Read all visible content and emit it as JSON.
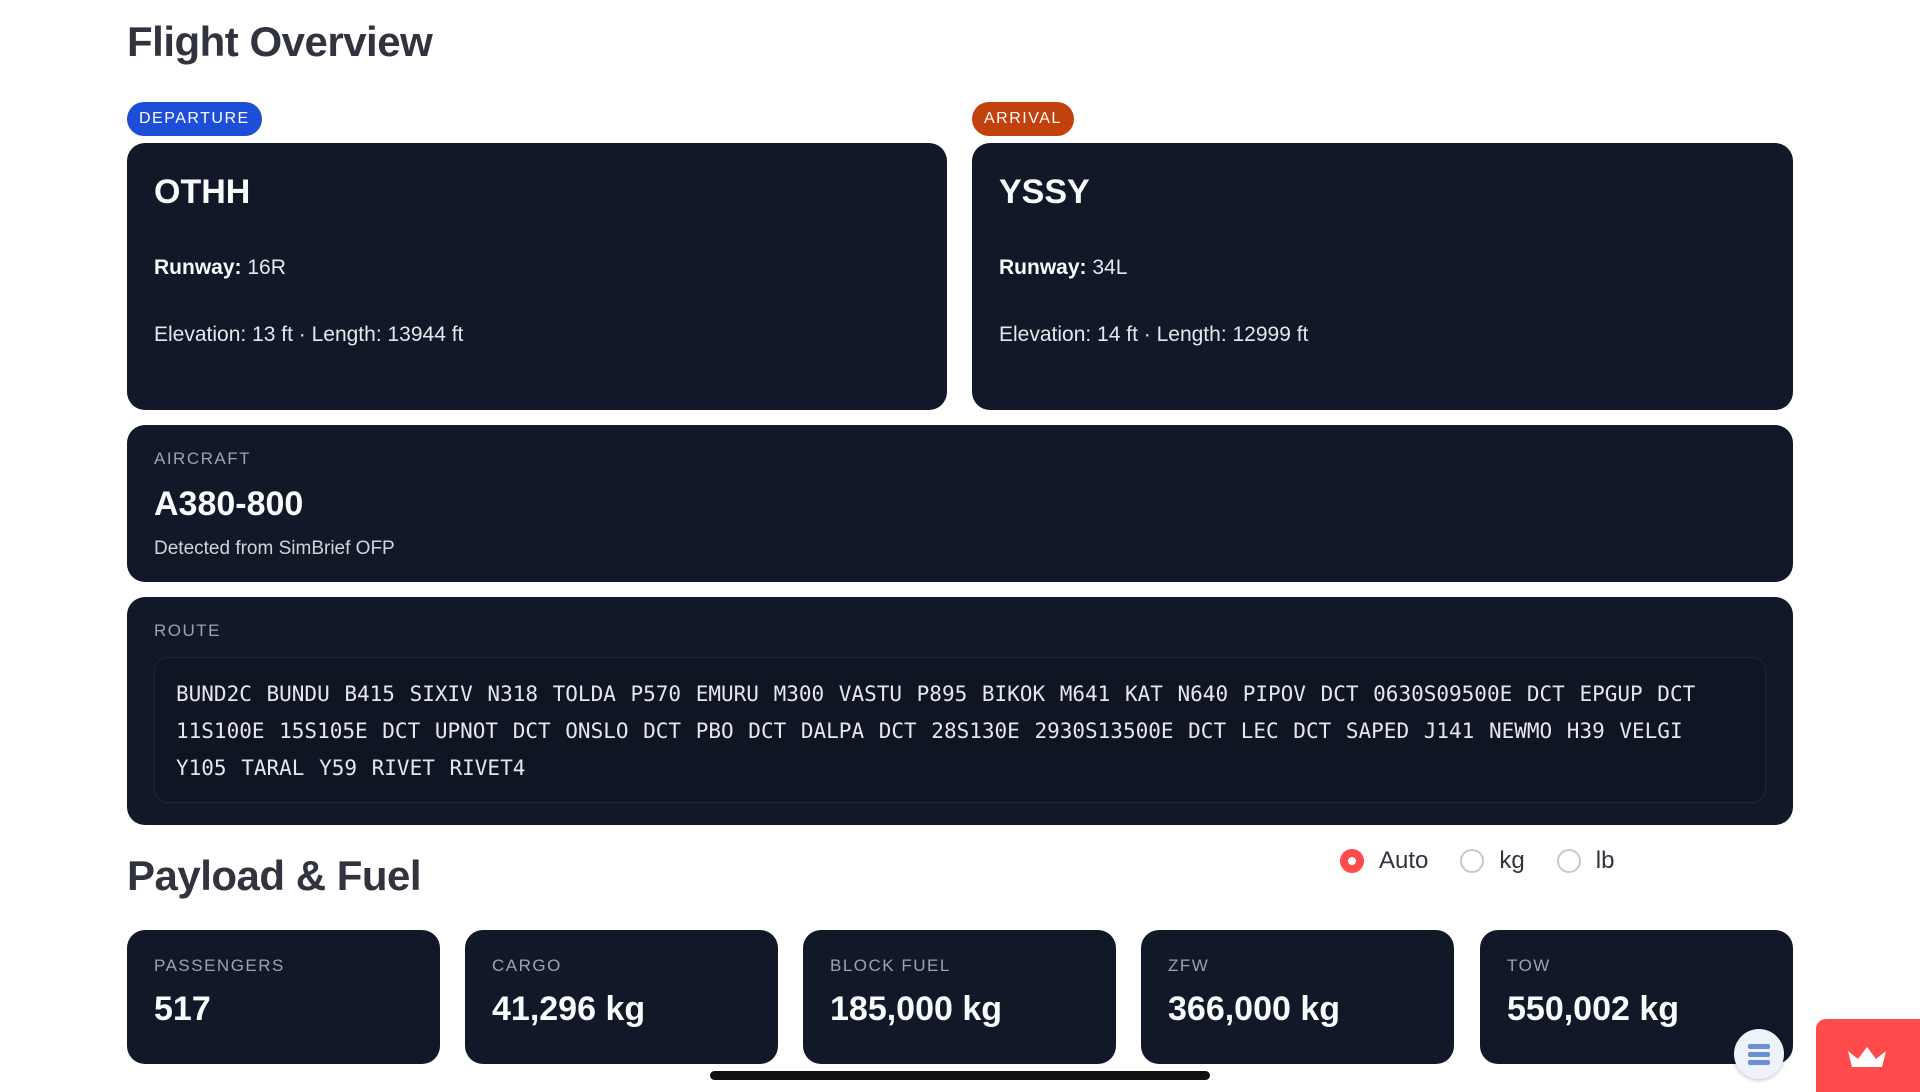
{
  "overview": {
    "title": "Flight Overview"
  },
  "departure": {
    "badge": "DEPARTURE",
    "code": "OTHH",
    "runway_label": "Runway:",
    "runway": "16R",
    "details": "Elevation: 13 ft · Length: 13944 ft"
  },
  "arrival": {
    "badge": "ARRIVAL",
    "code": "YSSY",
    "runway_label": "Runway:",
    "runway": "34L",
    "details": "Elevation: 14 ft · Length: 12999 ft"
  },
  "aircraft": {
    "label": "AIRCRAFT",
    "type": "A380-800",
    "source": "Detected from SimBrief OFP"
  },
  "route": {
    "label": "ROUTE",
    "text": "BUND2C BUNDU B415 SIXIV N318 TOLDA P570 EMURU M300 VASTU P895 BIKOK M641 KAT N640 PIPOV DCT 0630S09500E DCT EPGUP DCT 11S100E 15S105E DCT UPNOT DCT ONSLO DCT PBO DCT DALPA DCT 28S130E 2930S13500E DCT LEC DCT SAPED J141 NEWMO H39 VELGI Y105 TARAL Y59 RIVET RIVET4"
  },
  "payload": {
    "title": "Payload & Fuel",
    "units": {
      "options": [
        "Auto",
        "kg",
        "lb"
      ],
      "selected": "Auto"
    },
    "metrics": [
      {
        "label": "PASSENGERS",
        "value": "517"
      },
      {
        "label": "CARGO",
        "value": "41,296 kg"
      },
      {
        "label": "BLOCK FUEL",
        "value": "185,000 kg"
      },
      {
        "label": "ZFW",
        "value": "366,000 kg"
      },
      {
        "label": "TOW",
        "value": "550,002 kg"
      }
    ]
  },
  "colors": {
    "departure_badge": "#1d4ed8",
    "arrival_badge": "#c2410c",
    "card_bg": "#111827",
    "accent": "#ff4b4b"
  },
  "icons": {
    "deploy": "crown-icon",
    "fab": "menu-lines-icon"
  }
}
